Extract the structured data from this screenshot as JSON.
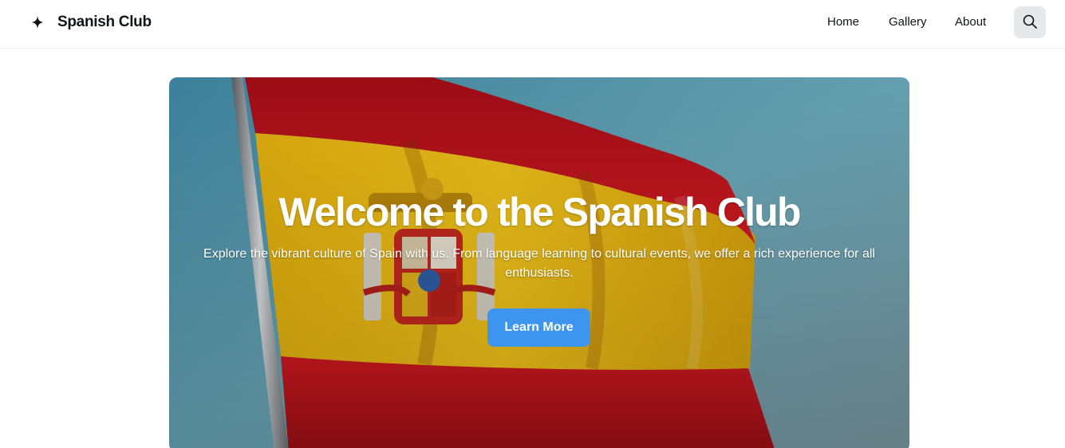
{
  "header": {
    "brand_name": "Spanish Club",
    "brand_icon": "sparkle-icon",
    "nav": [
      {
        "label": "Home"
      },
      {
        "label": "Gallery"
      },
      {
        "label": "About"
      }
    ],
    "search_icon": "search-icon"
  },
  "hero": {
    "title": "Welcome to the Spanish Club",
    "subtitle": "Explore the vibrant culture of Spain with us. From language learning to cultural events, we offer a rich experience for all enthusiasts.",
    "cta_label": "Learn More",
    "image": "spanish-flag-image"
  },
  "colors": {
    "accent": "#3d95f0",
    "search_bg": "#e6e8ec",
    "text": "#111418",
    "flag_red": "#c8131d",
    "flag_yellow": "#e9b810",
    "sky": "#5f9fb3"
  }
}
